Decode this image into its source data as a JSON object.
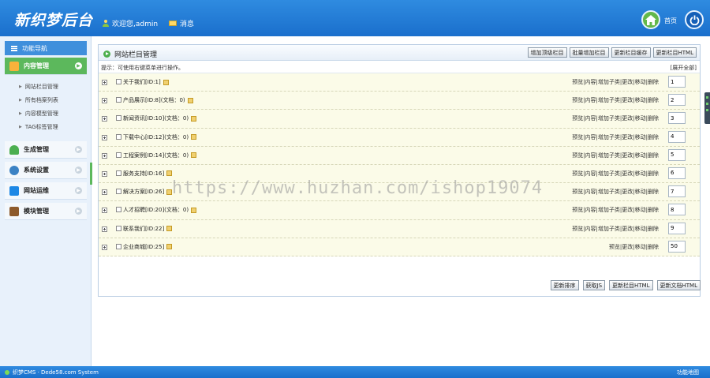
{
  "header": {
    "logo": "新织梦后台",
    "welcome": "欢迎您,admin",
    "message": "消息",
    "home": "首页"
  },
  "sidebar": {
    "nav_title": "功能导航",
    "menus": [
      {
        "label": "内容管理",
        "icon": "edit-icon",
        "color": "#f39c12",
        "active": true
      },
      {
        "label": "生成管理",
        "icon": "tree-icon",
        "color": "#4caf50"
      },
      {
        "label": "系统设置",
        "icon": "settings-icon",
        "color": "#3b82c4"
      },
      {
        "label": "网站运维",
        "icon": "monitor-icon",
        "color": "#1e88e5"
      },
      {
        "label": "模块管理",
        "icon": "book-icon",
        "color": "#8d5a2b"
      }
    ],
    "submenu": [
      "网站栏目管理",
      "所有档案列表",
      "内容模型管理",
      "TAG标签管理"
    ]
  },
  "panel": {
    "title": "网站栏目管理",
    "top_buttons": [
      "增加顶级栏目",
      "批量增加栏目",
      "更新栏目缓存",
      "更新栏目HTML"
    ],
    "tip": "提示：可使用右键菜单进行操作。",
    "expand_all": "[展开全部]",
    "rows": [
      {
        "name": "关于我们[ID:1]",
        "ops": "预览|内容|增加子类|更改|移动|删除",
        "order": "1"
      },
      {
        "name": "产品展示[ID:8](文档：0)",
        "ops": "预览|内容|增加子类|更改|移动|删除",
        "order": "2"
      },
      {
        "name": "新闻资讯[ID:10](文档：0)",
        "ops": "预览|内容|增加子类|更改|移动|删除",
        "order": "3"
      },
      {
        "name": "下载中心[ID:12](文档：0)",
        "ops": "预览|内容|增加子类|更改|移动|删除",
        "order": "4"
      },
      {
        "name": "工程案例[ID:14](文档：0)",
        "ops": "预览|内容|增加子类|更改|移动|删除",
        "order": "5"
      },
      {
        "name": "服务支持[ID:16]",
        "ops": "预览|内容|增加子类|更改|移动|删除",
        "order": "6"
      },
      {
        "name": "解决方案[ID:26]",
        "ops": "预览|内容|增加子类|更改|移动|删除",
        "order": "7"
      },
      {
        "name": "人才招聘[ID:20](文档：0)",
        "ops": "预览|内容|增加子类|更改|移动|删除",
        "order": "8"
      },
      {
        "name": "联系我们[ID:22]",
        "ops": "预览|内容|增加子类|更改|移动|删除",
        "order": "9"
      },
      {
        "name": "企业商城[ID:25]",
        "ops": "预览|更改|移动|删除",
        "order": "50"
      }
    ],
    "bottom_buttons": [
      "更新排序",
      "获取JS",
      "更新栏目HTML",
      "更新文档HTML"
    ]
  },
  "watermark": "https://www.huzhan.com/ishop19074",
  "footer": {
    "left": "织梦CMS · Dede58.com System",
    "right": "功能地图"
  }
}
